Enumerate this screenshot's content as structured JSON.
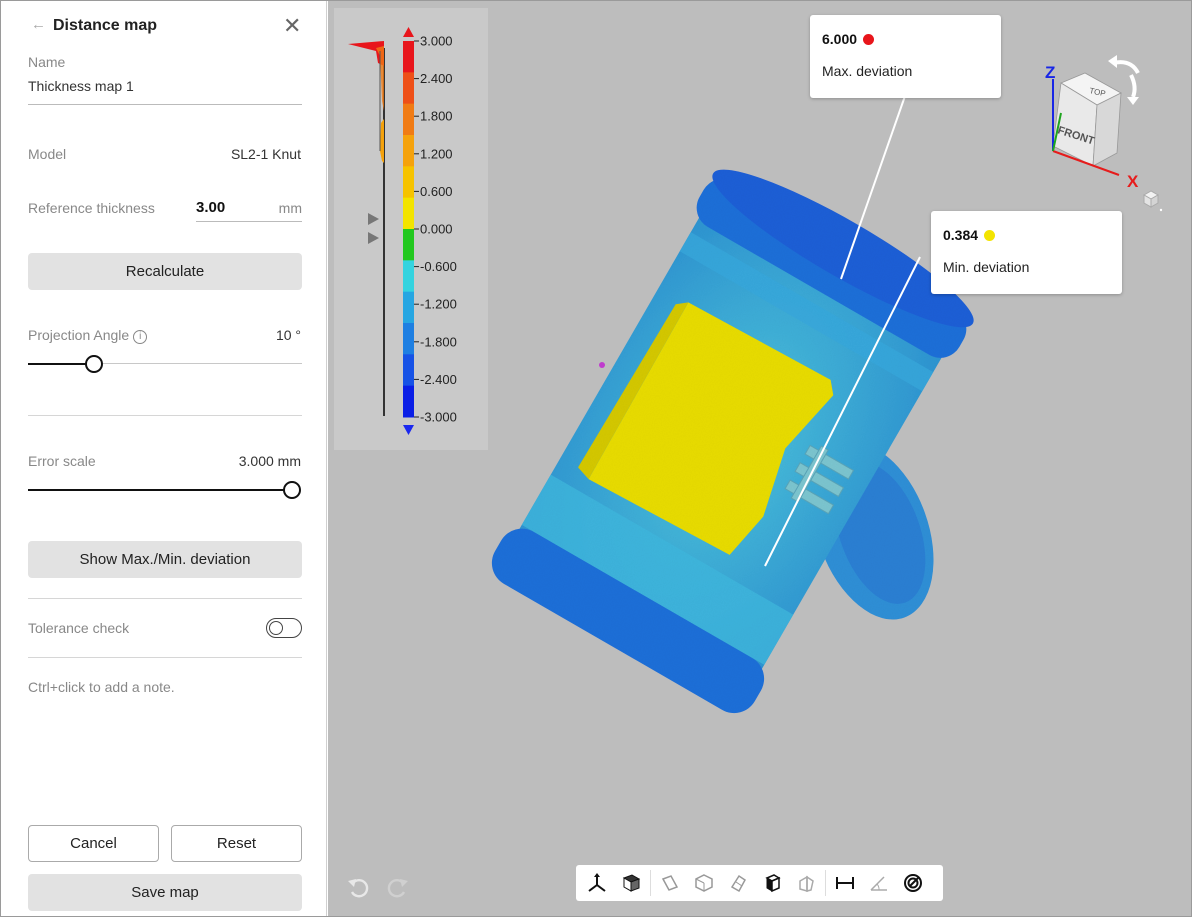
{
  "panel": {
    "back_glyph": "←",
    "title": "Distance map",
    "close_glyph": "✕",
    "name_label": "Name",
    "name_value": "Thickness map 1",
    "model_label": "Model",
    "model_value": "SL2-1 Knut",
    "ref_thickness_label": "Reference thickness",
    "ref_thickness_value": "3.00",
    "ref_thickness_unit": "mm",
    "recalculate_label": "Recalculate",
    "projection_angle_label": "Projection Angle",
    "projection_angle_value": "10 °",
    "projection_angle_fraction": 0.24,
    "error_scale_label": "Error scale",
    "error_scale_value": "3.000 mm",
    "error_scale_fraction": 1.0,
    "show_deviation_label": "Show Max./Min. deviation",
    "tolerance_label": "Tolerance check",
    "tolerance_on": false,
    "note_hint": "Ctrl+click to add a note.",
    "cancel_label": "Cancel",
    "reset_label": "Reset",
    "save_label": "Save map"
  },
  "colorbar": {
    "labels": [
      "3.000",
      "2.400",
      "1.800",
      "1.200",
      "0.600",
      "0.000",
      "-0.600",
      "-1.200",
      "-1.800",
      "-2.400",
      "-3.000"
    ],
    "colors": [
      "#e8151b",
      "#ee4f17",
      "#f07b14",
      "#f5a20c",
      "#f6c300",
      "#f3e400",
      "#22c81e",
      "#34d3df",
      "#26a6e2",
      "#1e7fe2",
      "#1652e6",
      "#0a1ee6"
    ],
    "over_color": "#e8151b",
    "under_color": "#1a28ef"
  },
  "callouts": {
    "max_value": "6.000",
    "max_label": "Max. deviation",
    "max_color": "#e8151b",
    "min_value": "0.384",
    "min_label": "Min. deviation",
    "min_color": "#f3e400"
  },
  "viewcube": {
    "top_label": "TOP",
    "front_label": "FRONT",
    "z_label": "Z",
    "x_label": "X"
  },
  "toolbar": {
    "icons": [
      "axes-icon",
      "shaded-cube-icon",
      "view-left-icon",
      "view-iso-icon",
      "view-right-icon",
      "view-front-icon",
      "view-back-icon",
      "measure-distance-icon",
      "measure-angle-icon",
      "spiral-icon"
    ]
  }
}
